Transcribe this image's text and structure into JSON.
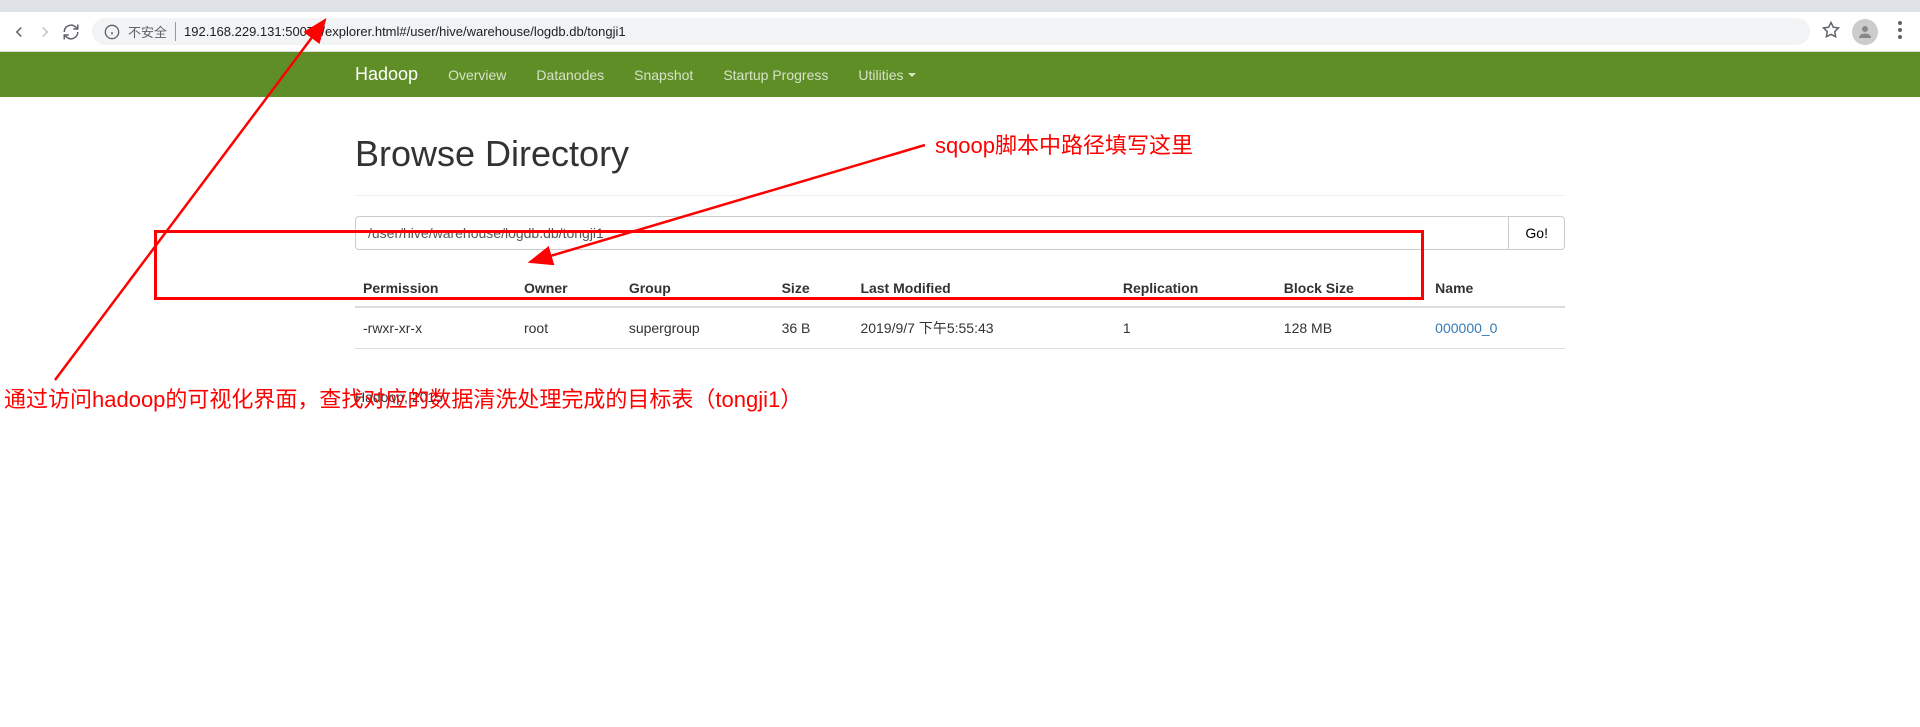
{
  "browser": {
    "security_text": "不安全",
    "url": "192.168.229.131:50070/explorer.html#/user/hive/warehouse/logdb.db/tongji1"
  },
  "nav": {
    "brand": "Hadoop",
    "links": [
      "Overview",
      "Datanodes",
      "Snapshot",
      "Startup Progress",
      "Utilities"
    ]
  },
  "page": {
    "title": "Browse Directory",
    "path_value": "/user/hive/warehouse/logdb.db/tongji1",
    "go_label": "Go!"
  },
  "table": {
    "headers": [
      "Permission",
      "Owner",
      "Group",
      "Size",
      "Last Modified",
      "Replication",
      "Block Size",
      "Name"
    ],
    "rows": [
      {
        "permission": "-rwxr-xr-x",
        "owner": "root",
        "group": "supergroup",
        "size": "36 B",
        "last_modified": "2019/9/7 下午5:55:43",
        "replication": "1",
        "block_size": "128 MB",
        "name": "000000_0"
      }
    ]
  },
  "footer": "Hadoop, 2015.",
  "annotations": {
    "note1": "sqoop脚本中路径填写这里",
    "note2": "通过访问hadoop的可视化界面，查找对应的数据清洗处理完成的目标表（tongji1）"
  }
}
